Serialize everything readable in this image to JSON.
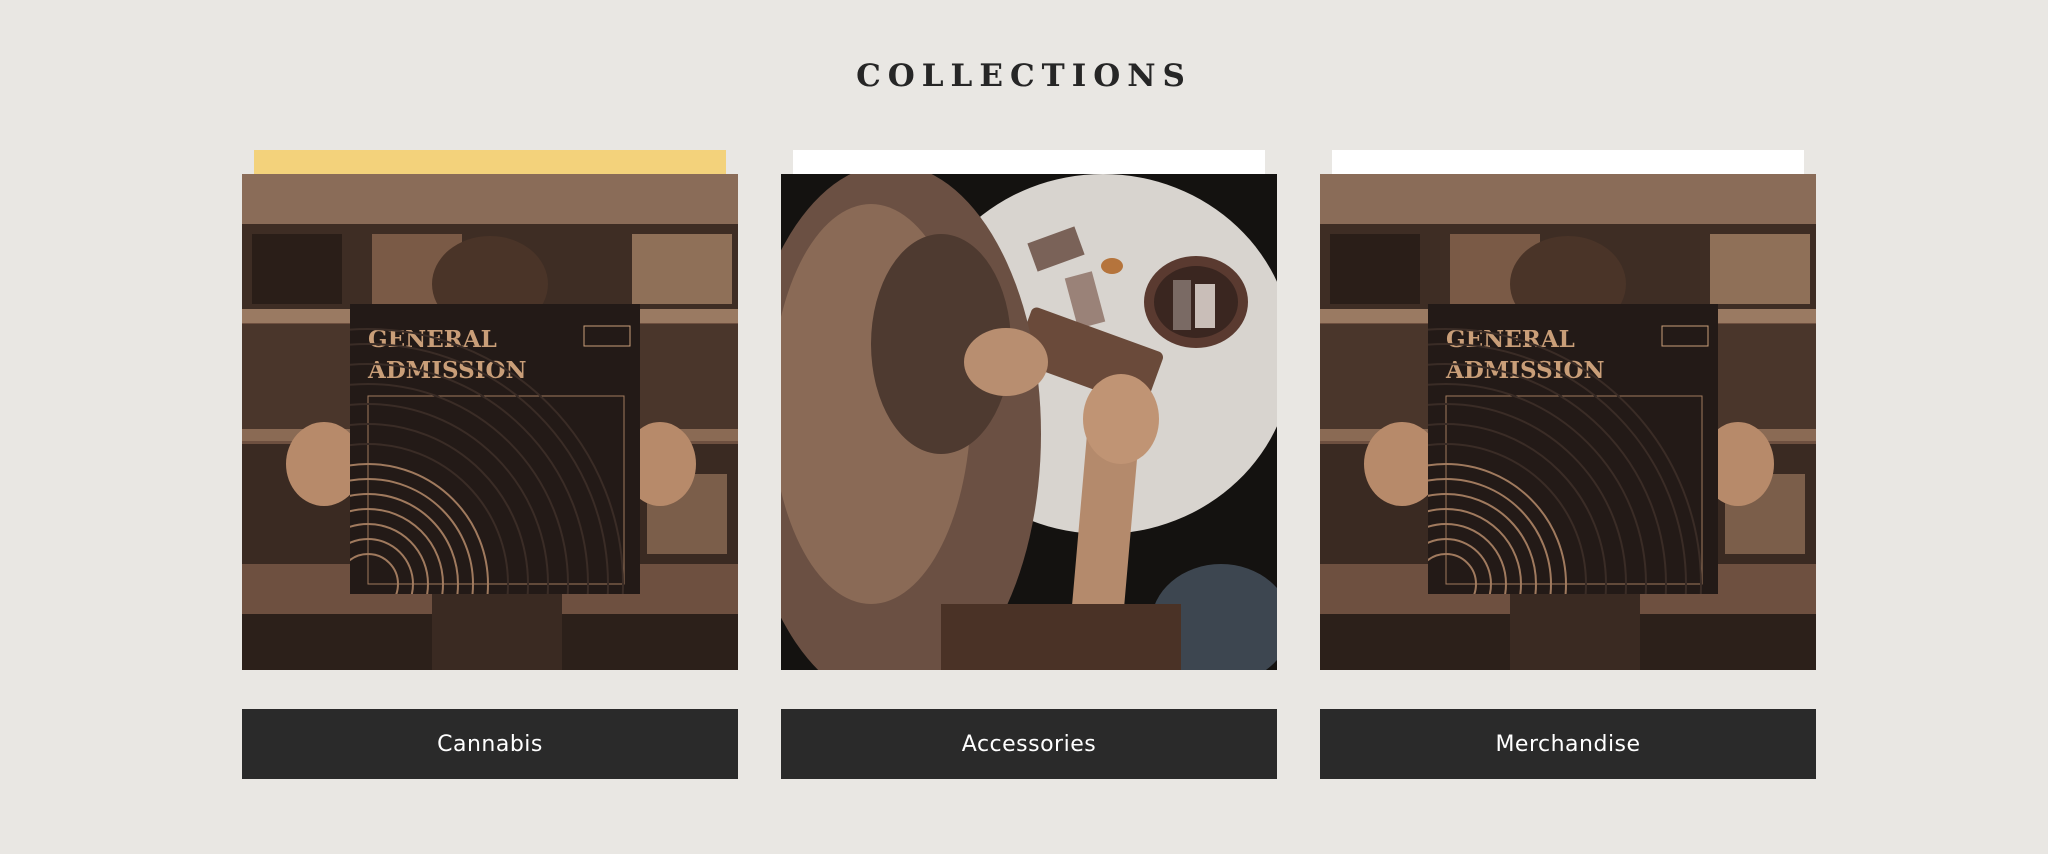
{
  "section": {
    "title": "COLLECTIONS"
  },
  "collections": [
    {
      "label": "Cannabis",
      "tab_color": "#f3d27b",
      "photo_icon": "record-sleeve-photo",
      "album": {
        "title_line1": "GENERAL",
        "title_line2": "ADMISSION"
      }
    },
    {
      "label": "Accessories",
      "tab_color": "#ffffff",
      "photo_icon": "rolling-tray-photo"
    },
    {
      "label": "Merchandise",
      "tab_color": "#ffffff",
      "photo_icon": "record-sleeve-photo",
      "album": {
        "title_line1": "GENERAL",
        "title_line2": "ADMISSION"
      }
    }
  ],
  "colors": {
    "background": "#e9e7e3",
    "button_bg": "#2a2a2a",
    "button_text": "#ffffff",
    "accent_tab": "#f3d27b"
  }
}
